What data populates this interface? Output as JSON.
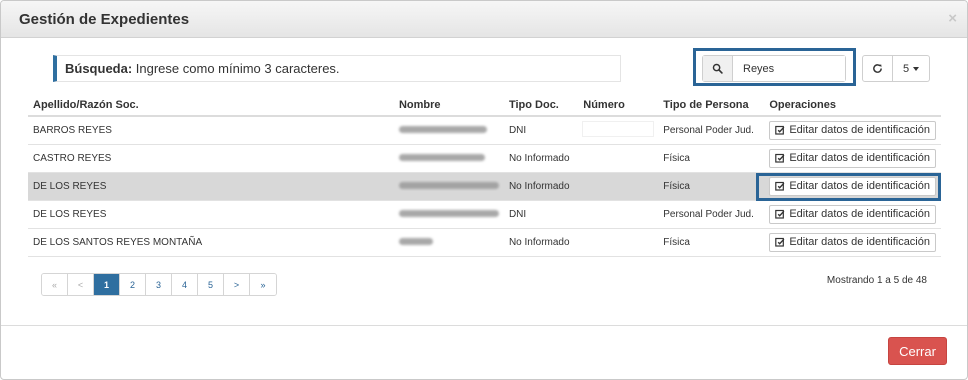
{
  "modal": {
    "title": "Gestión de Expedientes",
    "close_symbol": "×"
  },
  "search": {
    "hint_label": "Búsqueda:",
    "hint_text": " Ingrese como mínimo 3 caracteres.",
    "value": "Reyes",
    "icon": "search-icon"
  },
  "toolbar": {
    "refresh_icon": "refresh-icon",
    "page_size": "5"
  },
  "table": {
    "headers": [
      "Apellido/Razón Soc.",
      "Nombre",
      "Tipo Doc.",
      "Número",
      "Tipo de Persona",
      "Operaciones"
    ],
    "rows": [
      {
        "apellido": "BARROS REYES",
        "tipo_doc": "DNI",
        "tipo_persona": "Personal Poder Jud.",
        "op": "Editar datos de identificación"
      },
      {
        "apellido": "CASTRO REYES",
        "tipo_doc": "No Informado",
        "tipo_persona": "Física",
        "op": "Editar datos de identificación"
      },
      {
        "apellido": "DE LOS REYES",
        "tipo_doc": "No Informado",
        "tipo_persona": "Física",
        "op": "Editar datos de identificación"
      },
      {
        "apellido": "DE LOS REYES",
        "tipo_doc": "DNI",
        "tipo_persona": "Personal Poder Jud.",
        "op": "Editar datos de identificación"
      },
      {
        "apellido": "DE LOS SANTOS REYES MONTAÑA",
        "tipo_doc": "No Informado",
        "tipo_persona": "Física",
        "op": "Editar datos de identificación"
      }
    ]
  },
  "pagination": {
    "items": [
      "«",
      "<",
      "1",
      "2",
      "3",
      "4",
      "5",
      ">",
      "»"
    ],
    "active": "1",
    "summary": "Mostrando 1 a 5 de 48"
  },
  "footer": {
    "close_label": "Cerrar"
  },
  "colors": {
    "accent": "#2f6fa0",
    "danger": "#d9534f",
    "highlight_border": "#2a6496"
  }
}
